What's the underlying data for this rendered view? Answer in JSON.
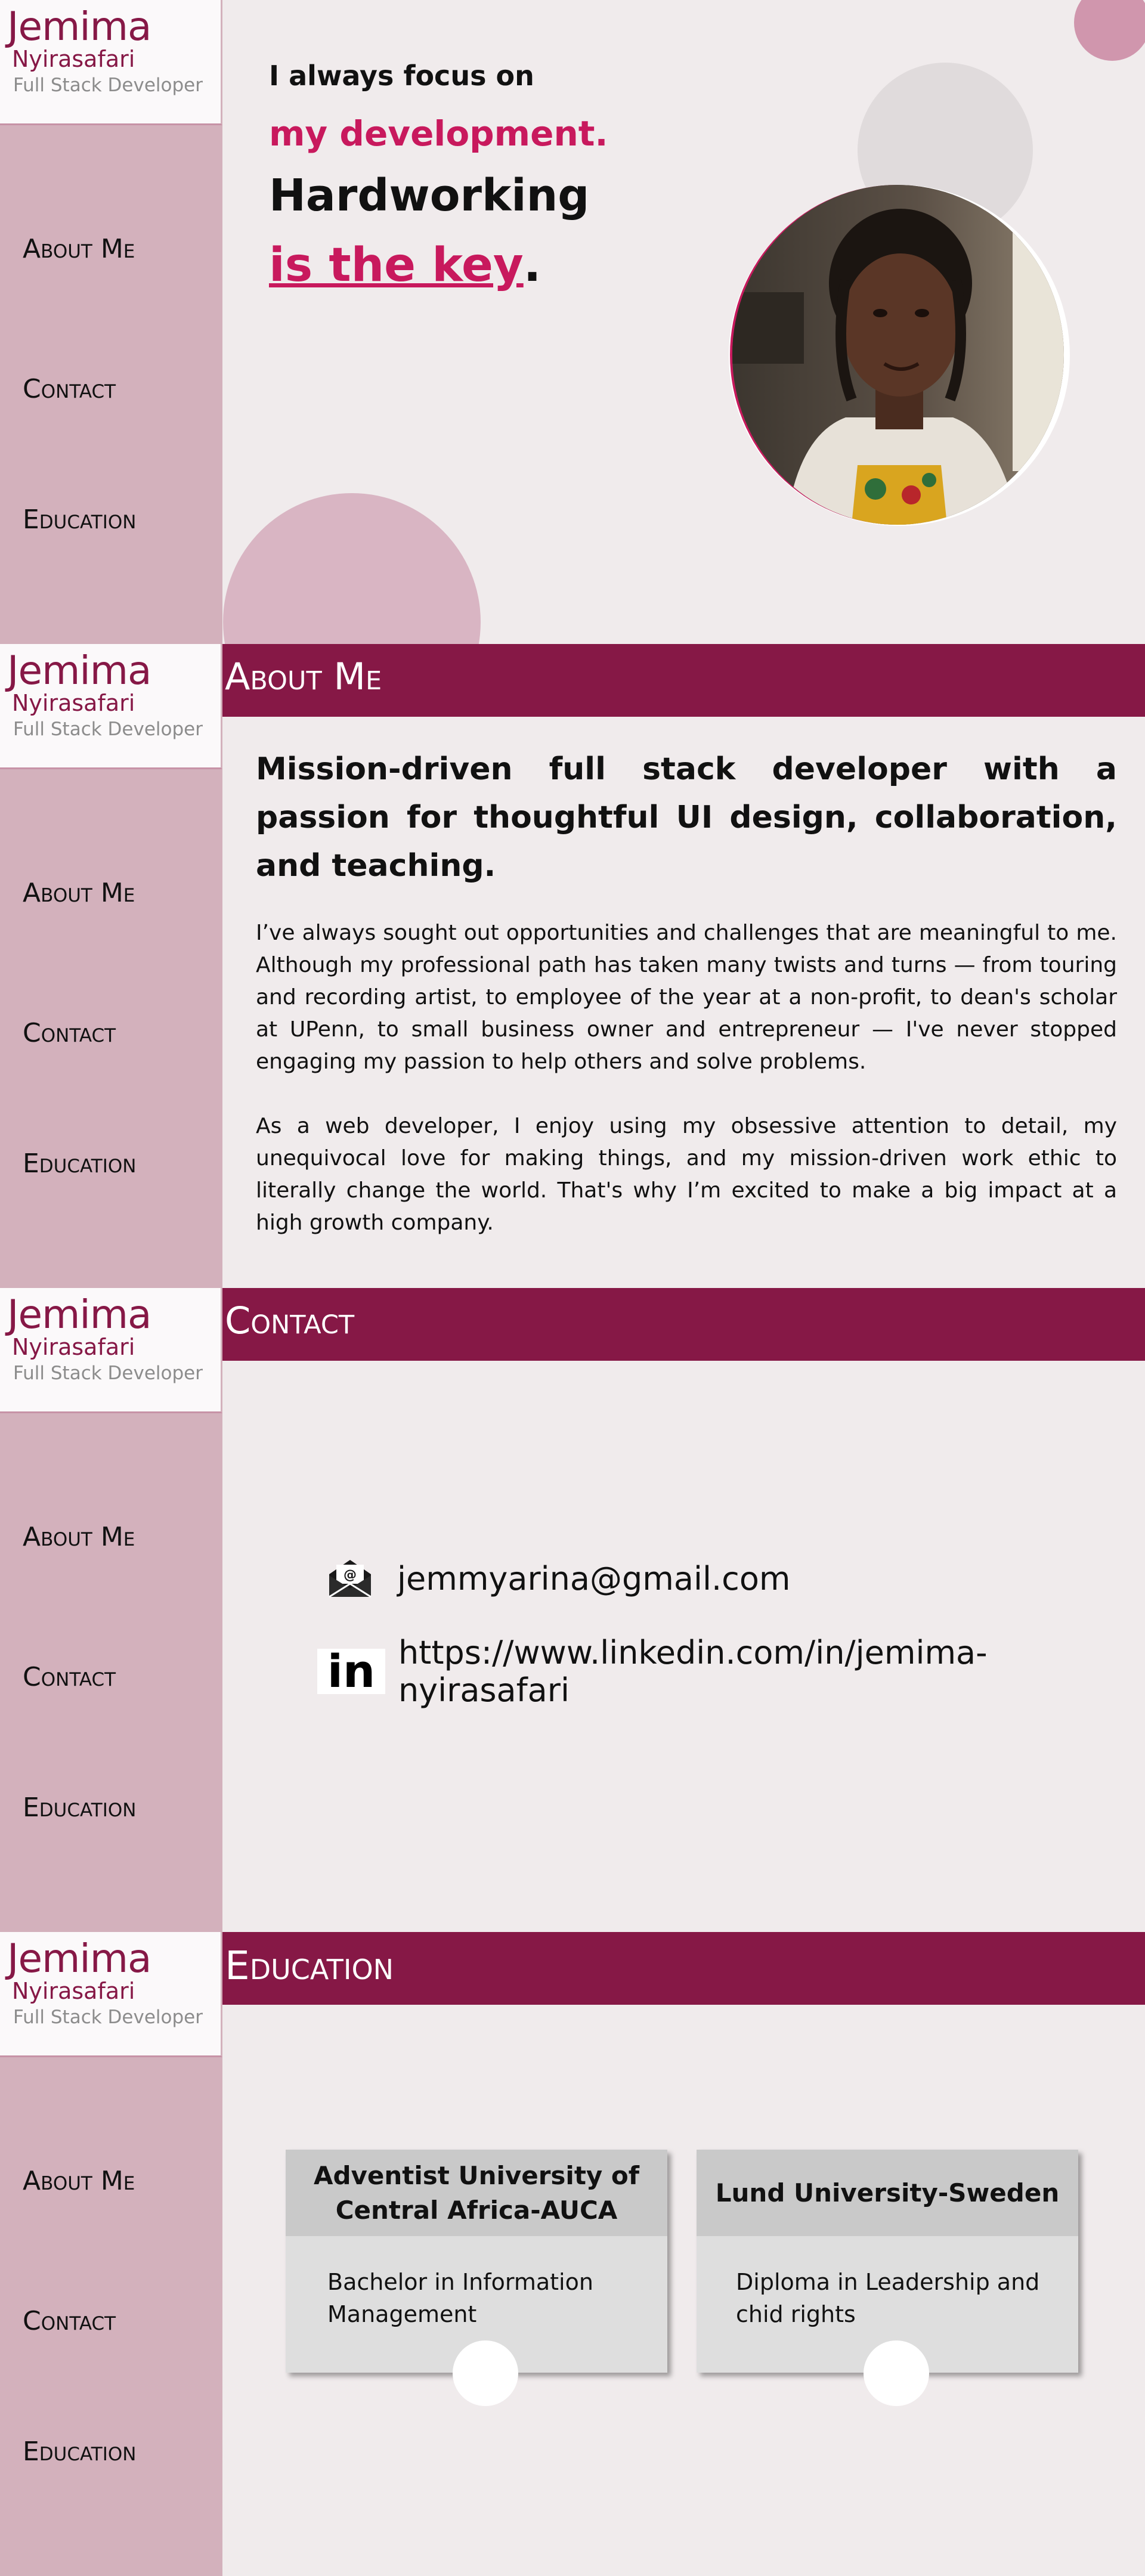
{
  "brand": {
    "first_name": "Jemima",
    "last_name": "Nyirasafari",
    "role": "Full Stack Developer"
  },
  "nav": {
    "about": "About Me",
    "contact": "Contact",
    "education": "Education"
  },
  "hero": {
    "line1": "I always focus on",
    "line2": "my development.",
    "line3": "Hardworking",
    "line4": "is the key",
    "line4_end": "."
  },
  "about": {
    "header": "About Me",
    "title": "Mission-driven full stack developer with a passion for thoughtful UI design, collaboration, and teaching.",
    "paragraph1": "I’ve always sought out opportunities and challenges that are meaningful to me. Although my professional path has taken many twists and turns — from touring and recording artist, to employee of the year at a non-profit, to dean's scholar at UPenn, to small business owner and entrepreneur — I've never stopped engaging my passion to help others and solve problems.",
    "paragraph2": "As a web developer, I enjoy using my obsessive attention to detail, my unequivocal love for making things, and my mission-driven work ethic to literally change the world. That's why I’m excited to make a big impact at a high growth company."
  },
  "contact": {
    "header": "Contact",
    "email": "jemmyarina@gmail.com",
    "linkedin": "https://www.linkedin.com/in/jemima-nyirasafari",
    "email_icon_glyph": "@",
    "linkedin_icon_glyph": "in"
  },
  "education": {
    "header": "Education",
    "cards": [
      {
        "school": "Adventist University of Central Africa-AUCA",
        "degree": "Bachelor in Information Management"
      },
      {
        "school": "Lund University-Sweden",
        "degree": "Diploma in Leadership and chid rights"
      }
    ]
  },
  "colors": {
    "accent": "#861846",
    "highlight": "#c8195d",
    "sidebar": "#d3b1bc",
    "background": "#f0ebec"
  }
}
